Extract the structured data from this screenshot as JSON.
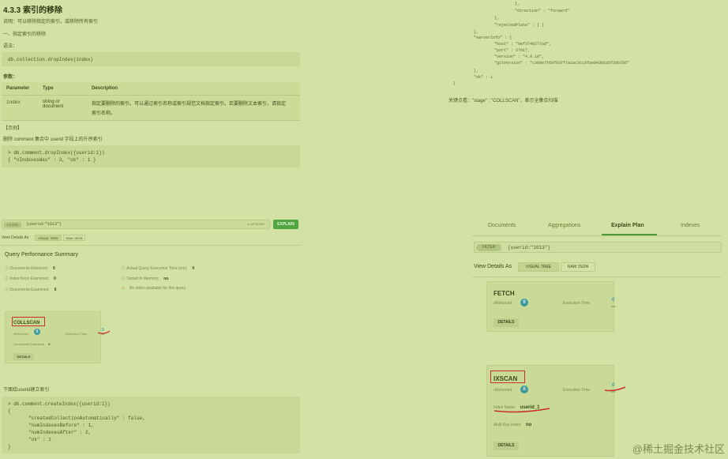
{
  "doc": {
    "title": "4.3.3 索引的移除",
    "desc": "说明：可以移除指定的索引，或移除所有索引",
    "sub1": "一、指定索引的移除",
    "syntax_label": "语法：",
    "syntax_code": "db.collection.dropIndex(index)",
    "params_label": "参数：",
    "params_headers": [
      "Parameter",
      "Type",
      "Description"
    ],
    "params_row": {
      "name": "index",
      "type_line1": "string or",
      "type_line2": "document",
      "desc_line1": "指定要删除的索引。可以通过索引名称或索引规范文档指定索引。若要删除文本索引，请指定",
      "desc_line2": "索引名称。"
    },
    "example_label": "【示例】",
    "example_desc": "删除 comment 集合中 userid 字段上的升序索引",
    "example_code1": "> db.comment.dropIndex({userid:1})",
    "example_code2": "{ \"nIndexesWas\" : 3, \"ok\" : 1 }"
  },
  "topcode": {
    "lines": [
      "},",
      "\"direction\" : \"forward\"",
      "},",
      "\"rejectedPlans\" : [ ]",
      "},",
      "\"serverInfo\" : {",
      "\"host\" : \"9ef3740277ad\",",
      "\"port\" : 27017,",
      "\"version\" : \"4.0.10\",",
      "\"gitVersion\" : \"c389e7f69f637f7a1ac3cc9fae843b635f20b766\"",
      "},",
      "\"ok\" : 1",
      "}"
    ],
    "note": "关键点看：\"stage\" : \"COLLSCAN\"，表示全集合扫描"
  },
  "left_panel": {
    "filter_chip": "FILTER",
    "filter_text": "{userid:\"1013\"}",
    "options": "▸ OPTIONS",
    "explain": "EXPLAIN",
    "view_details": "View Details As",
    "visual_tree": "VISUAL TREE",
    "raw_json": "RAW JSON",
    "qps_title": "Query Performance Summary",
    "m1_label": "Documents Returned:",
    "m1_value": "0",
    "m2_label": "Index Keys Examined:",
    "m2_value": "0",
    "m3_label": "Documents Examined:",
    "m3_value": "6",
    "m4_label": "Actual Query Execution Time (ms):",
    "m4_value": "0",
    "m5_label": "Sorted in Memory:",
    "m5_value": "no",
    "m6_label": "No index available for this query.",
    "stage": "COLLSCAN",
    "nreturned": "nReturned",
    "nreturned_value": "0",
    "exec_time": "Execution Time",
    "exec_value": "0",
    "exec_unit": "ms",
    "docs_examined": "Documents Examined",
    "docs_examined_value": "6",
    "details": "DETAILS"
  },
  "bottom_left": {
    "desc": "下面给userid建立索引",
    "lines": [
      "> db.comment.createIndex({userid:1})",
      "{",
      "\"createdCollectionAutomatically\" : false,",
      "\"numIndexesBefore\" : 1,",
      "\"numIndexesAfter\" : 2,",
      "\"ok\" : 1",
      "}"
    ]
  },
  "right_panel": {
    "tabs": [
      "Documents",
      "Aggregations",
      "Explain Plan",
      "Indexes"
    ],
    "filter_chip": "FILTER",
    "filter_text": "{userid:\"1013\"}",
    "view_details": "View Details As",
    "visual_tree": "VISUAL TREE",
    "raw_json": "RAW JSON",
    "fetch": "FETCH",
    "nreturned": "nReturned",
    "nreturned_value": "0",
    "exec_time": "Execution Time",
    "exec_value": "0",
    "exec_unit": "ms",
    "details": "DETAILS",
    "ixscan": "IXSCAN",
    "index_name_label": "Index Name:",
    "index_name": "userid_1",
    "multi_key_label": "Multi Key Index:",
    "multi_key": "no"
  },
  "watermark": "@稀土掘金技术社区",
  "colors": {
    "background": "#d2e1a4",
    "explain_button": "#52a642",
    "badge": "#3e9aa0",
    "highlight_red": "#c8302a"
  }
}
